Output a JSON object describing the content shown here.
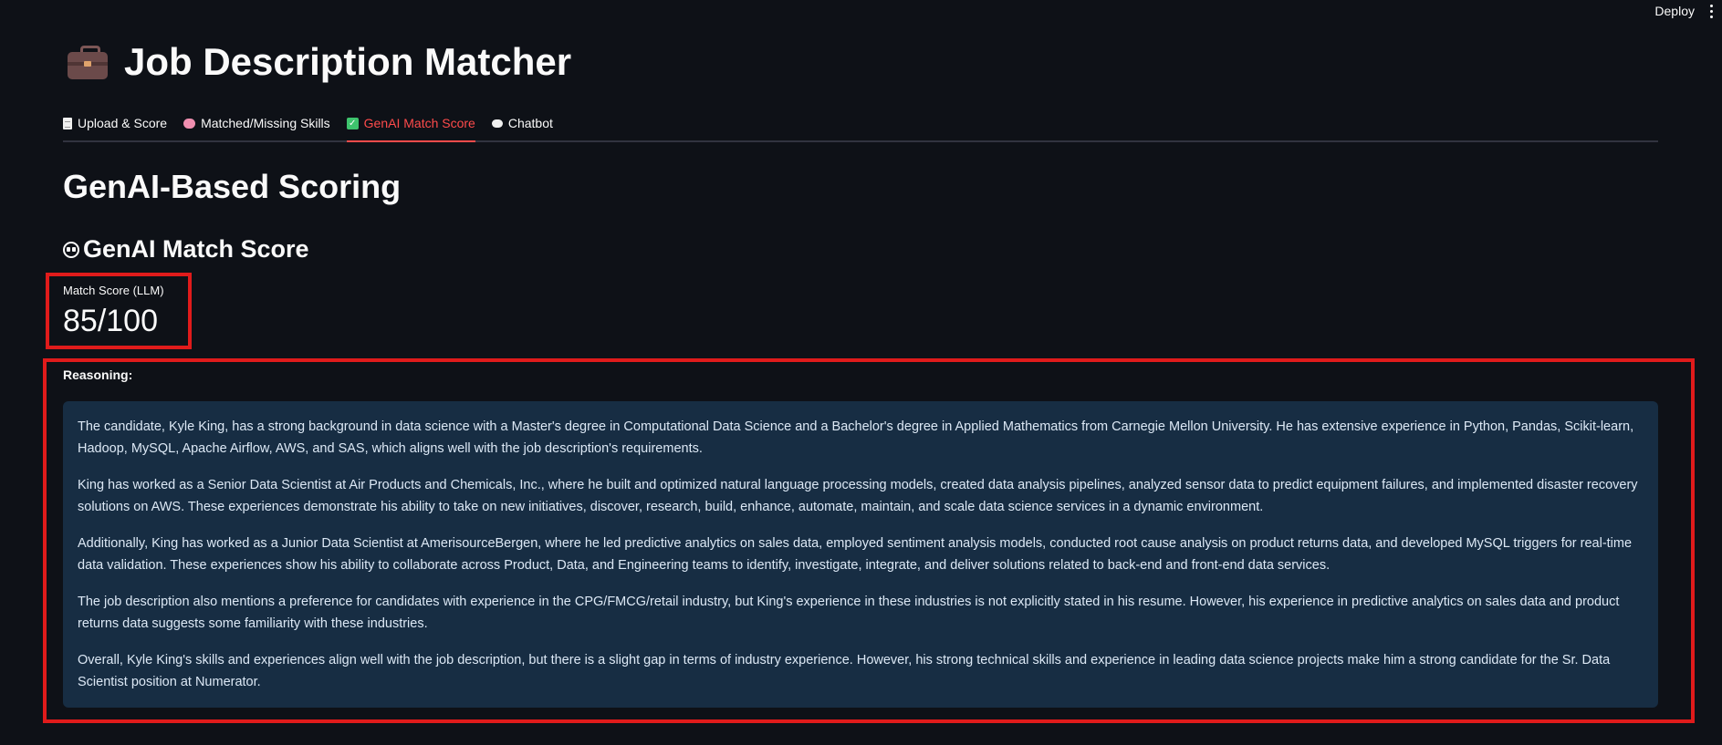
{
  "topbar": {
    "deploy_label": "Deploy"
  },
  "app": {
    "title": "Job Description Matcher",
    "title_icon": "briefcase-icon"
  },
  "tabs": [
    {
      "label": "Upload & Score",
      "icon": "document-icon",
      "active": false
    },
    {
      "label": "Matched/Missing Skills",
      "icon": "brain-icon",
      "active": false
    },
    {
      "label": "GenAI Match Score",
      "icon": "check-icon",
      "active": true
    },
    {
      "label": "Chatbot",
      "icon": "speech-bubble-icon",
      "active": false
    }
  ],
  "section": {
    "title": "GenAI-Based Scoring",
    "subtitle": "GenAI Match Score",
    "subtitle_icon": "robot-face-icon"
  },
  "metric": {
    "label": "Match Score (LLM)",
    "value": "85/100"
  },
  "reasoning": {
    "label": "Reasoning:",
    "paragraphs": [
      "The candidate, Kyle King, has a strong background in data science with a Master's degree in Computational Data Science and a Bachelor's degree in Applied Mathematics from Carnegie Mellon University. He has extensive experience in Python, Pandas, Scikit-learn, Hadoop, MySQL, Apache Airflow, AWS, and SAS, which aligns well with the job description's requirements.",
      "King has worked as a Senior Data Scientist at Air Products and Chemicals, Inc., where he built and optimized natural language processing models, created data analysis pipelines, analyzed sensor data to predict equipment failures, and implemented disaster recovery solutions on AWS. These experiences demonstrate his ability to take on new initiatives, discover, research, build, enhance, automate, maintain, and scale data science services in a dynamic environment.",
      "Additionally, King has worked as a Junior Data Scientist at AmerisourceBergen, where he led predictive analytics on sales data, employed sentiment analysis models, conducted root cause analysis on product returns data, and developed MySQL triggers for real-time data validation. These experiences show his ability to collaborate across Product, Data, and Engineering teams to identify, investigate, integrate, and deliver solutions related to back-end and front-end data services.",
      "The job description also mentions a preference for candidates with experience in the CPG/FMCG/retail industry, but King's experience in these industries is not explicitly stated in his resume. However, his experience in predictive analytics on sales data and product returns data suggests some familiarity with these industries.",
      "Overall, Kyle King's skills and experiences align well with the job description, but there is a slight gap in terms of industry experience. However, his strong technical skills and experience in leading data science projects make him a strong candidate for the Sr. Data Scientist position at Numerator."
    ]
  },
  "colors": {
    "background": "#0e1117",
    "accent": "#ff4b4b",
    "highlight_border": "#e01b1b",
    "info_panel": "#172d43"
  }
}
